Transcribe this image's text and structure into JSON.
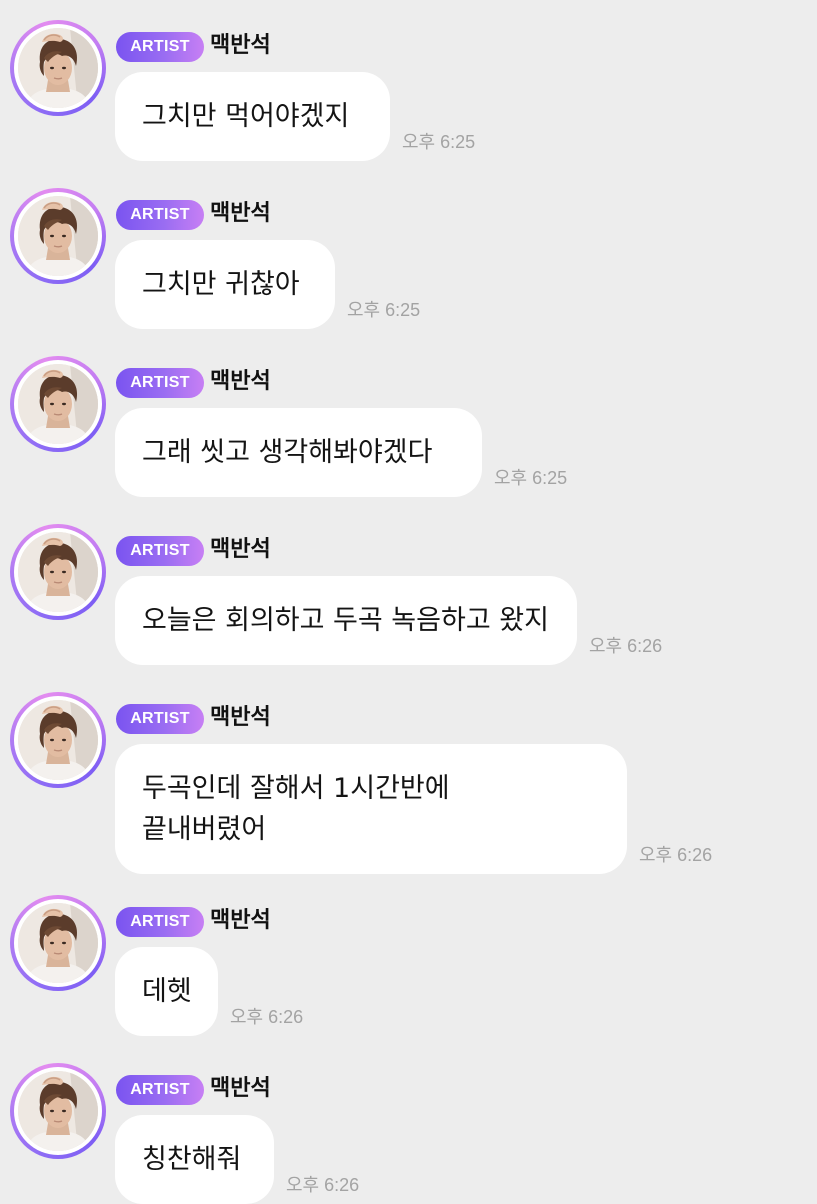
{
  "badge_label": "ARTIST",
  "messages": [
    {
      "name": "맥반석",
      "lines": [
        "그치만 먹어야겠지"
      ],
      "time": "오후 6:25"
    },
    {
      "name": "맥반석",
      "lines": [
        "그치만 귀찮아"
      ],
      "time": "오후 6:25"
    },
    {
      "name": "맥반석",
      "lines": [
        "그래 씻고 생각해봐야겠다"
      ],
      "time": "오후 6:25"
    },
    {
      "name": "맥반석",
      "lines": [
        "오늘은 회의하고 두곡 녹음하고 왔지"
      ],
      "time": "오후 6:26"
    },
    {
      "name": "맥반석",
      "lines": [
        "두곡인데 잘해서 1시간반에",
        "끝내버렸어"
      ],
      "time": "오후 6:26"
    },
    {
      "name": "맥반석",
      "lines": [
        "데헷"
      ],
      "time": "오후 6:26"
    },
    {
      "name": "맥반석",
      "lines": [
        "칭찬해줘"
      ],
      "time": "오후 6:26"
    }
  ],
  "colors": {
    "background": "#ededed",
    "bubble": "#ffffff",
    "badge_start": "#7a54f0",
    "badge_end": "#c77ff4",
    "ring": "#a774f3",
    "time_text": "#a3a3a3"
  },
  "icons": {
    "avatar": "artist-profile-photo"
  }
}
